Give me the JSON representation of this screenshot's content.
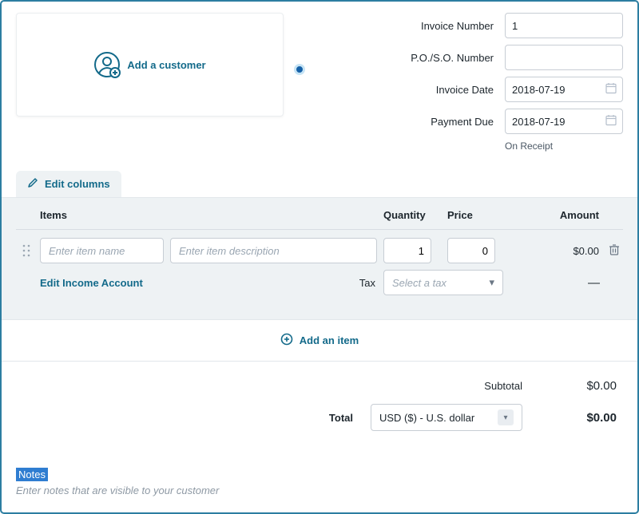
{
  "customer": {
    "add_label": "Add a customer"
  },
  "meta": {
    "invoice_number_label": "Invoice Number",
    "invoice_number_value": "1",
    "poso_label": "P.O./S.O. Number",
    "poso_value": "",
    "invoice_date_label": "Invoice Date",
    "invoice_date_value": "2018-07-19",
    "payment_due_label": "Payment Due",
    "payment_due_value": "2018-07-19",
    "on_receipt": "On Receipt"
  },
  "toolbar": {
    "edit_columns": "Edit columns"
  },
  "grid": {
    "headers": {
      "items": "Items",
      "quantity": "Quantity",
      "price": "Price",
      "amount": "Amount"
    },
    "row": {
      "name_placeholder": "Enter item name",
      "desc_placeholder": "Enter item description",
      "qty_value": "1",
      "price_value": "0",
      "amount": "$0.00"
    },
    "edit_income": "Edit Income Account",
    "tax_label": "Tax",
    "tax_placeholder": "Select a tax",
    "dash": "—"
  },
  "add_item": "Add an item",
  "totals": {
    "subtotal_label": "Subtotal",
    "subtotal_value": "$0.00",
    "total_label": "Total",
    "currency": "USD ($) - U.S. dollar",
    "total_value": "$0.00"
  },
  "notes": {
    "label": "Notes",
    "placeholder": "Enter notes that are visible to your customer"
  }
}
